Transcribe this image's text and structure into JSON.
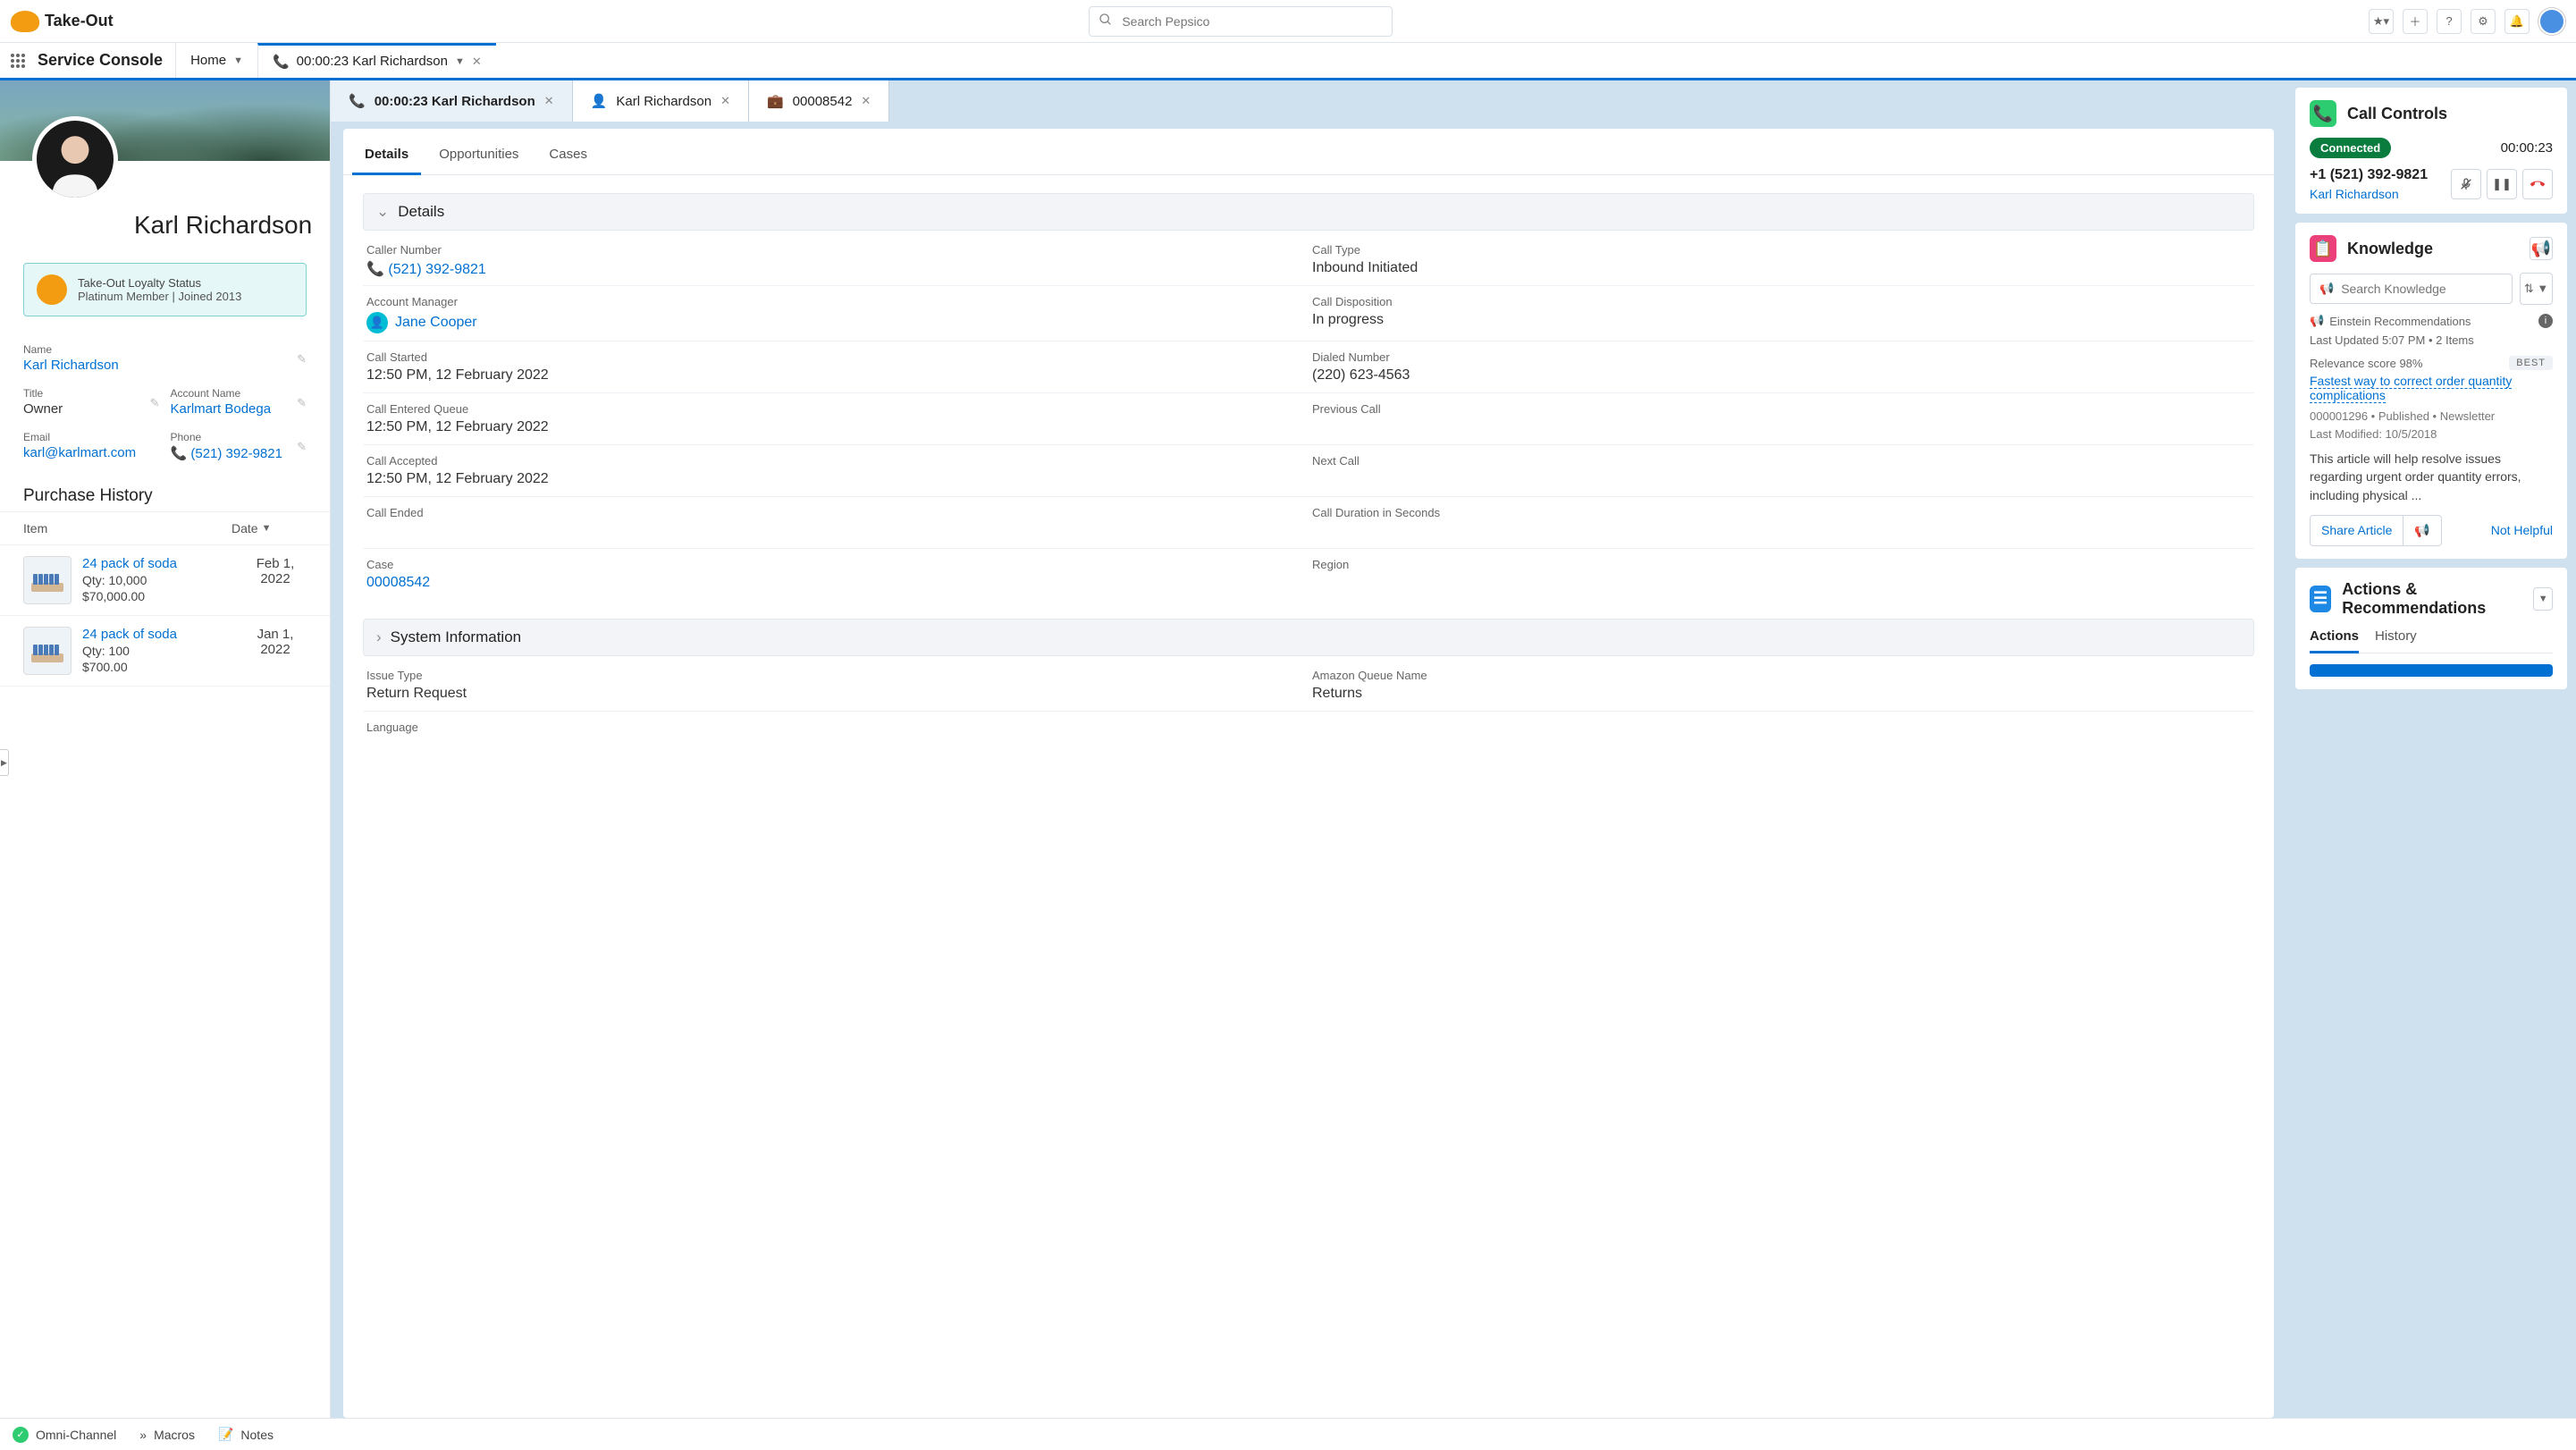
{
  "brand": "Take-Out",
  "search_placeholder": "Search Pepsico",
  "app_name": "Service Console",
  "nav_tabs": [
    {
      "label": "Home"
    },
    {
      "label": "00:00:23 Karl Richardson",
      "active": true
    }
  ],
  "sub_tabs": [
    {
      "icon": "phone",
      "label": "00:00:23 Karl Richardson",
      "active": true
    },
    {
      "icon": "contact",
      "label": "Karl Richardson"
    },
    {
      "icon": "case",
      "label": "00008542"
    }
  ],
  "profile": {
    "name": "Karl Richardson",
    "loyalty_title": "Take-Out Loyalty Status",
    "loyalty_sub": "Platinum Member | Joined 2013",
    "fields": {
      "name_label": "Name",
      "name_value": "Karl Richardson",
      "title_label": "Title",
      "title_value": "Owner",
      "account_label": "Account Name",
      "account_value": "Karlmart Bodega",
      "email_label": "Email",
      "email_value": "karl@karlmart.com",
      "phone_label": "Phone",
      "phone_value": "(521) 392-9821"
    },
    "purchase_title": "Purchase History",
    "purchase_cols": {
      "item": "Item",
      "date": "Date"
    },
    "purchases": [
      {
        "name": "24 pack of soda",
        "qty": "Qty: 10,000",
        "amount": "$70,000.00",
        "date": "Feb 1, 2022"
      },
      {
        "name": "24 pack of soda",
        "qty": "Qty: 100",
        "amount": "$700.00",
        "date": "Jan 1, 2022"
      }
    ]
  },
  "main_tabs": [
    "Details",
    "Opportunities",
    "Cases"
  ],
  "details": {
    "heading": "Details",
    "fields": {
      "caller_number_l": "Caller Number",
      "caller_number_v": "(521) 392-9821",
      "call_type_l": "Call Type",
      "call_type_v": "Inbound Initiated",
      "account_manager_l": "Account Manager",
      "account_manager_v": "Jane Cooper",
      "call_disposition_l": "Call Disposition",
      "call_disposition_v": "In progress",
      "call_started_l": "Call Started",
      "call_started_v": "12:50 PM, 12 February 2022",
      "dialed_number_l": "Dialed Number",
      "dialed_number_v": "(220) 623-4563",
      "call_entered_queue_l": "Call Entered Queue",
      "call_entered_queue_v": "12:50 PM, 12 February 2022",
      "previous_call_l": "Previous Call",
      "previous_call_v": "",
      "call_accepted_l": "Call Accepted",
      "call_accepted_v": "12:50 PM, 12 February 2022",
      "next_call_l": "Next Call",
      "next_call_v": "",
      "call_ended_l": "Call Ended",
      "call_ended_v": "",
      "call_duration_l": "Call Duration in Seconds",
      "call_duration_v": "",
      "case_l": "Case",
      "case_v": "00008542",
      "region_l": "Region",
      "region_v": ""
    }
  },
  "system_info": {
    "heading": "System Information",
    "issue_type_l": "Issue Type",
    "issue_type_v": "Return Request",
    "amazon_queue_l": "Amazon Queue Name",
    "amazon_queue_v": "Returns",
    "language_l": "Language"
  },
  "call_controls": {
    "title": "Call Controls",
    "status": "Connected",
    "timer": "00:00:23",
    "number": "+1 (521) 392-9821",
    "name": "Karl Richardson"
  },
  "knowledge": {
    "title": "Knowledge",
    "search_placeholder": "Search Knowledge",
    "rec_label": "Einstein Recommendations",
    "updated": "Last Updated 5:07 PM • 2 Items",
    "relevance": "Relevance score 98%",
    "best": "BEST",
    "article": "Fastest way to correct order quantity complications",
    "meta1": "000001296  •  Published  •  Newsletter",
    "meta2": "Last Modified: 10/5/2018",
    "body": "This article will help resolve issues regarding urgent order quantity errors, including physical ...",
    "share": "Share Article",
    "not_helpful": "Not Helpful"
  },
  "actions": {
    "title": "Actions & Recommendations",
    "tabs": [
      "Actions",
      "History"
    ]
  },
  "footer": {
    "omni": "Omni-Channel",
    "macros": "Macros",
    "notes": "Notes"
  }
}
